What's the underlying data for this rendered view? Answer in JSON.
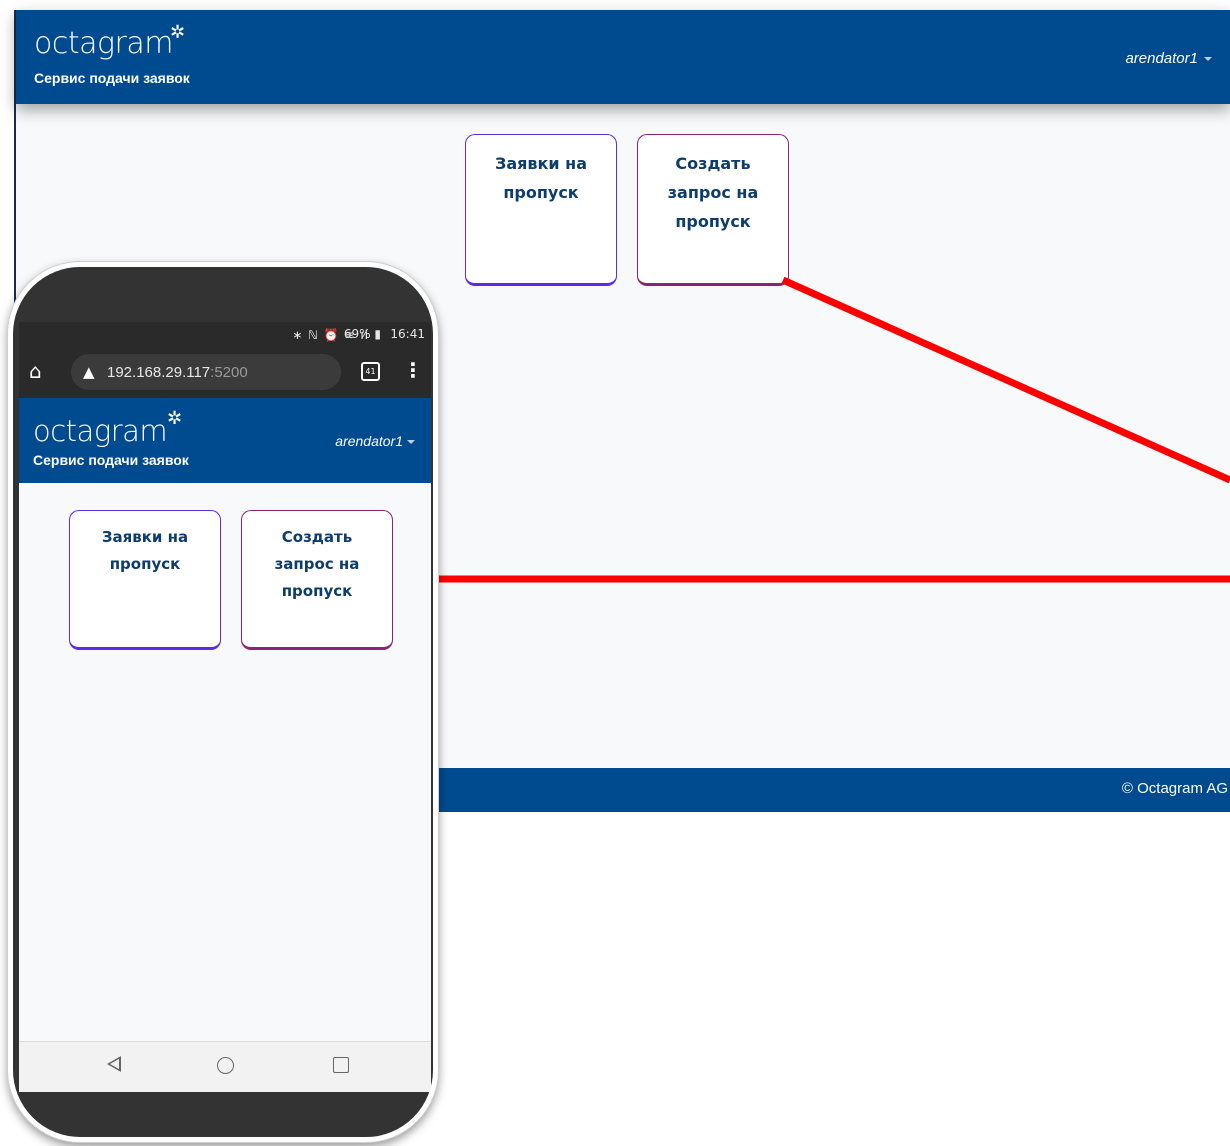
{
  "desktop": {
    "brand": "octagram",
    "brand_star": "✲",
    "subtitle": "Сервис подачи заявок",
    "user": "arendator1",
    "tiles": [
      {
        "label": "Заявки на пропуск"
      },
      {
        "label": "Создать запрос на пропуск"
      }
    ],
    "footer": "© Octagram AG"
  },
  "phone": {
    "status": {
      "icons": "∗ ℕ ⏰ ≋ ıl",
      "battery": "69%",
      "battery_icon": "▮",
      "time": "16:41"
    },
    "browser": {
      "url_host": "192.168.29.117",
      "url_port": ":5200",
      "tab_count": "41"
    },
    "brand": "octagram",
    "brand_star": "✲",
    "subtitle": "Сервис подачи заявок",
    "user": "arendator1",
    "tiles": [
      {
        "label": "Заявки на пропуск"
      },
      {
        "label": "Создать запрос на пропуск"
      }
    ]
  },
  "colors": {
    "header": "#004a8f",
    "tile_purple": "#5b2be8",
    "tile_magenta": "#8b2478",
    "arrow": "#ff0000"
  }
}
